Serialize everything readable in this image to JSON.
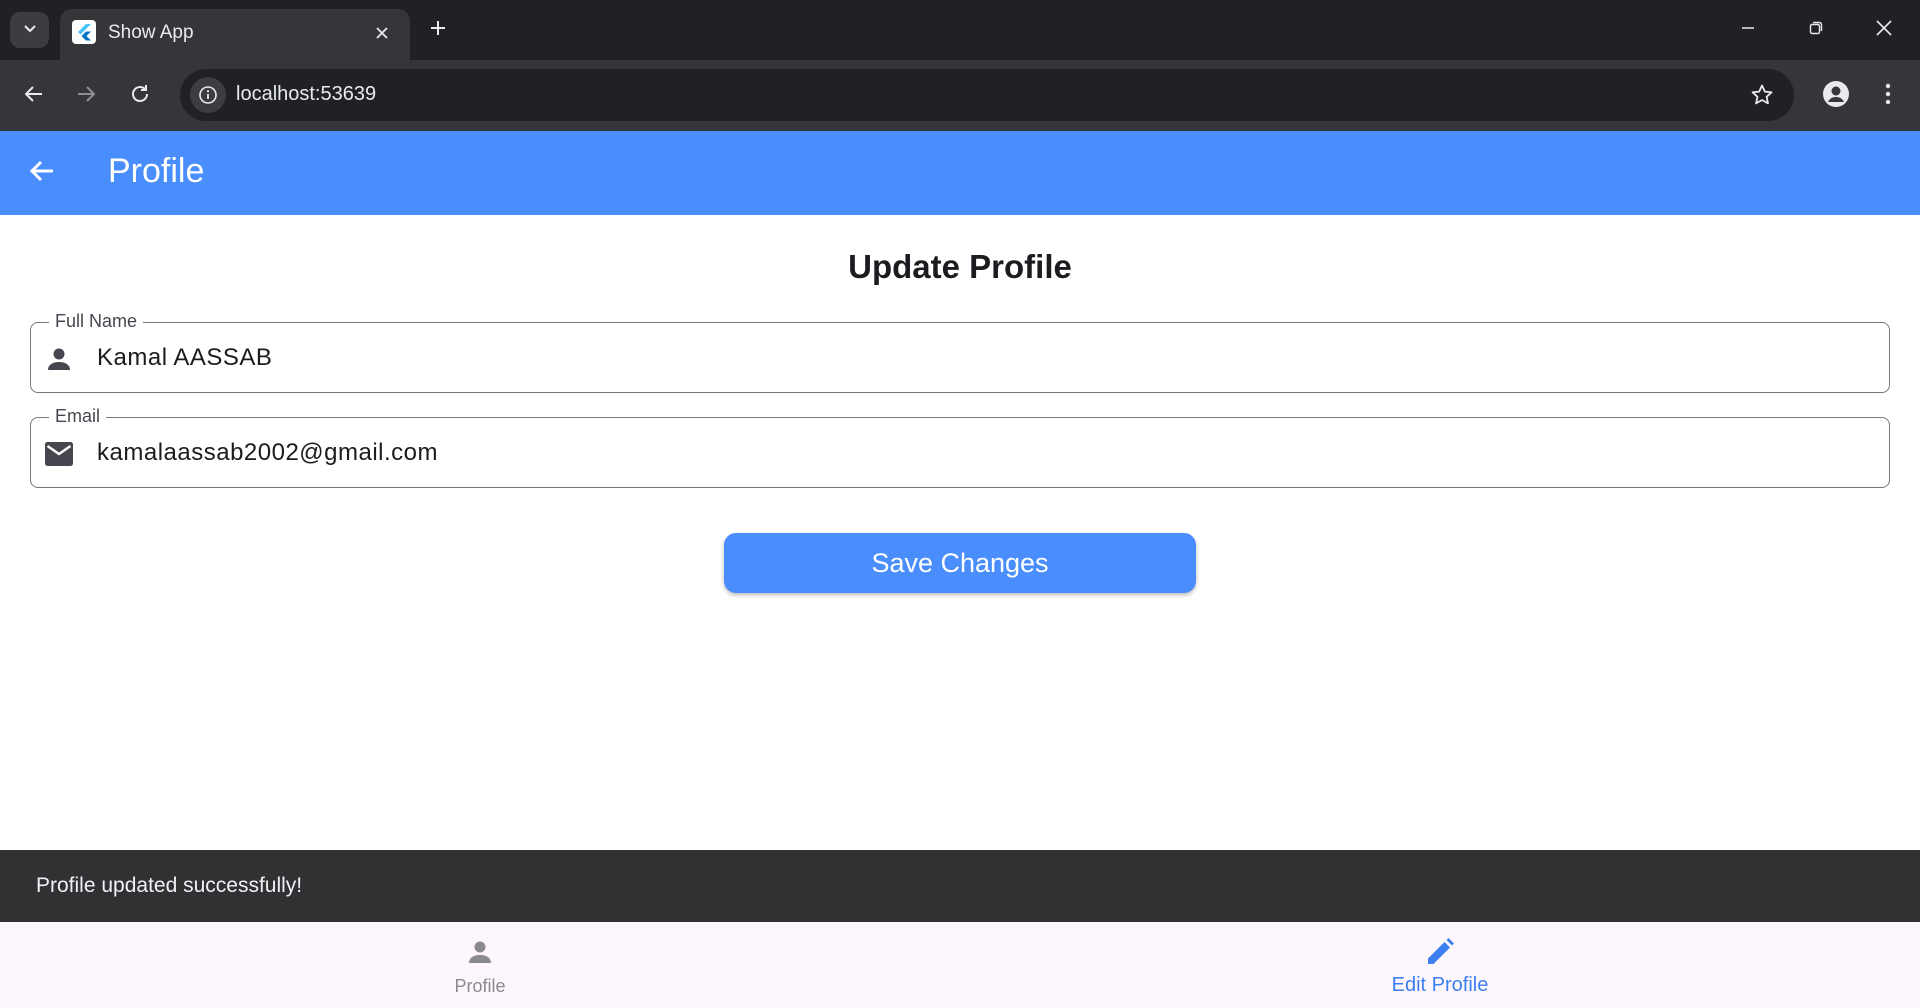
{
  "browser": {
    "tab": {
      "title": "Show App",
      "favicon": "flutter-logo-icon"
    },
    "url": "localhost:53639",
    "colors": {
      "tabbar": "#202124",
      "toolbar": "#35363a",
      "omnibox": "#202124"
    }
  },
  "app": {
    "appbar": {
      "title": "Profile",
      "back_icon": "arrow-back-icon",
      "color": "#4a8dfc"
    },
    "page_heading": "Update Profile",
    "form": {
      "full_name": {
        "label": "Full Name",
        "value": "Kamal AASSAB",
        "icon": "person-icon"
      },
      "email": {
        "label": "Email",
        "value": "kamalaassab2002@gmail.com",
        "icon": "mail-icon"
      }
    },
    "save_button": "Save Changes",
    "snackbar": {
      "message": "Profile updated successfully!"
    },
    "bottom_nav": {
      "items": [
        {
          "label": "Profile",
          "icon": "person-icon",
          "active": false
        },
        {
          "label": "Edit Profile",
          "icon": "edit-pencil-icon",
          "active": true
        }
      ],
      "active_color": "#3b7ff0"
    }
  }
}
